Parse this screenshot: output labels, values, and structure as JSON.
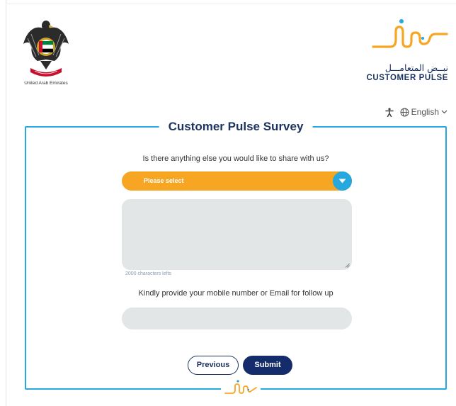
{
  "header": {
    "uae_caption": "United Arab Emirates",
    "brand_arabic": "نبــض المتعامـــل",
    "brand_english": "CUSTOMER PULSE"
  },
  "toolbar": {
    "accessibility_icon": "accessibility-icon",
    "globe_icon": "globe-icon",
    "language": "English"
  },
  "survey": {
    "title": "Customer Pulse Survey",
    "question1": "Is there anything else you would like to share with us?",
    "select_placeholder": "Please select",
    "comment_value": "",
    "char_count": "2000 characters lefts",
    "question2": "Kindly provide your mobile number or Email for follow up",
    "contact_value": "",
    "previous_label": "Previous",
    "submit_label": "Submit"
  },
  "colors": {
    "accent_blue": "#26a7de",
    "accent_orange": "#f6a623",
    "navy": "#142c6b",
    "field_bg": "#e2e6e6"
  }
}
